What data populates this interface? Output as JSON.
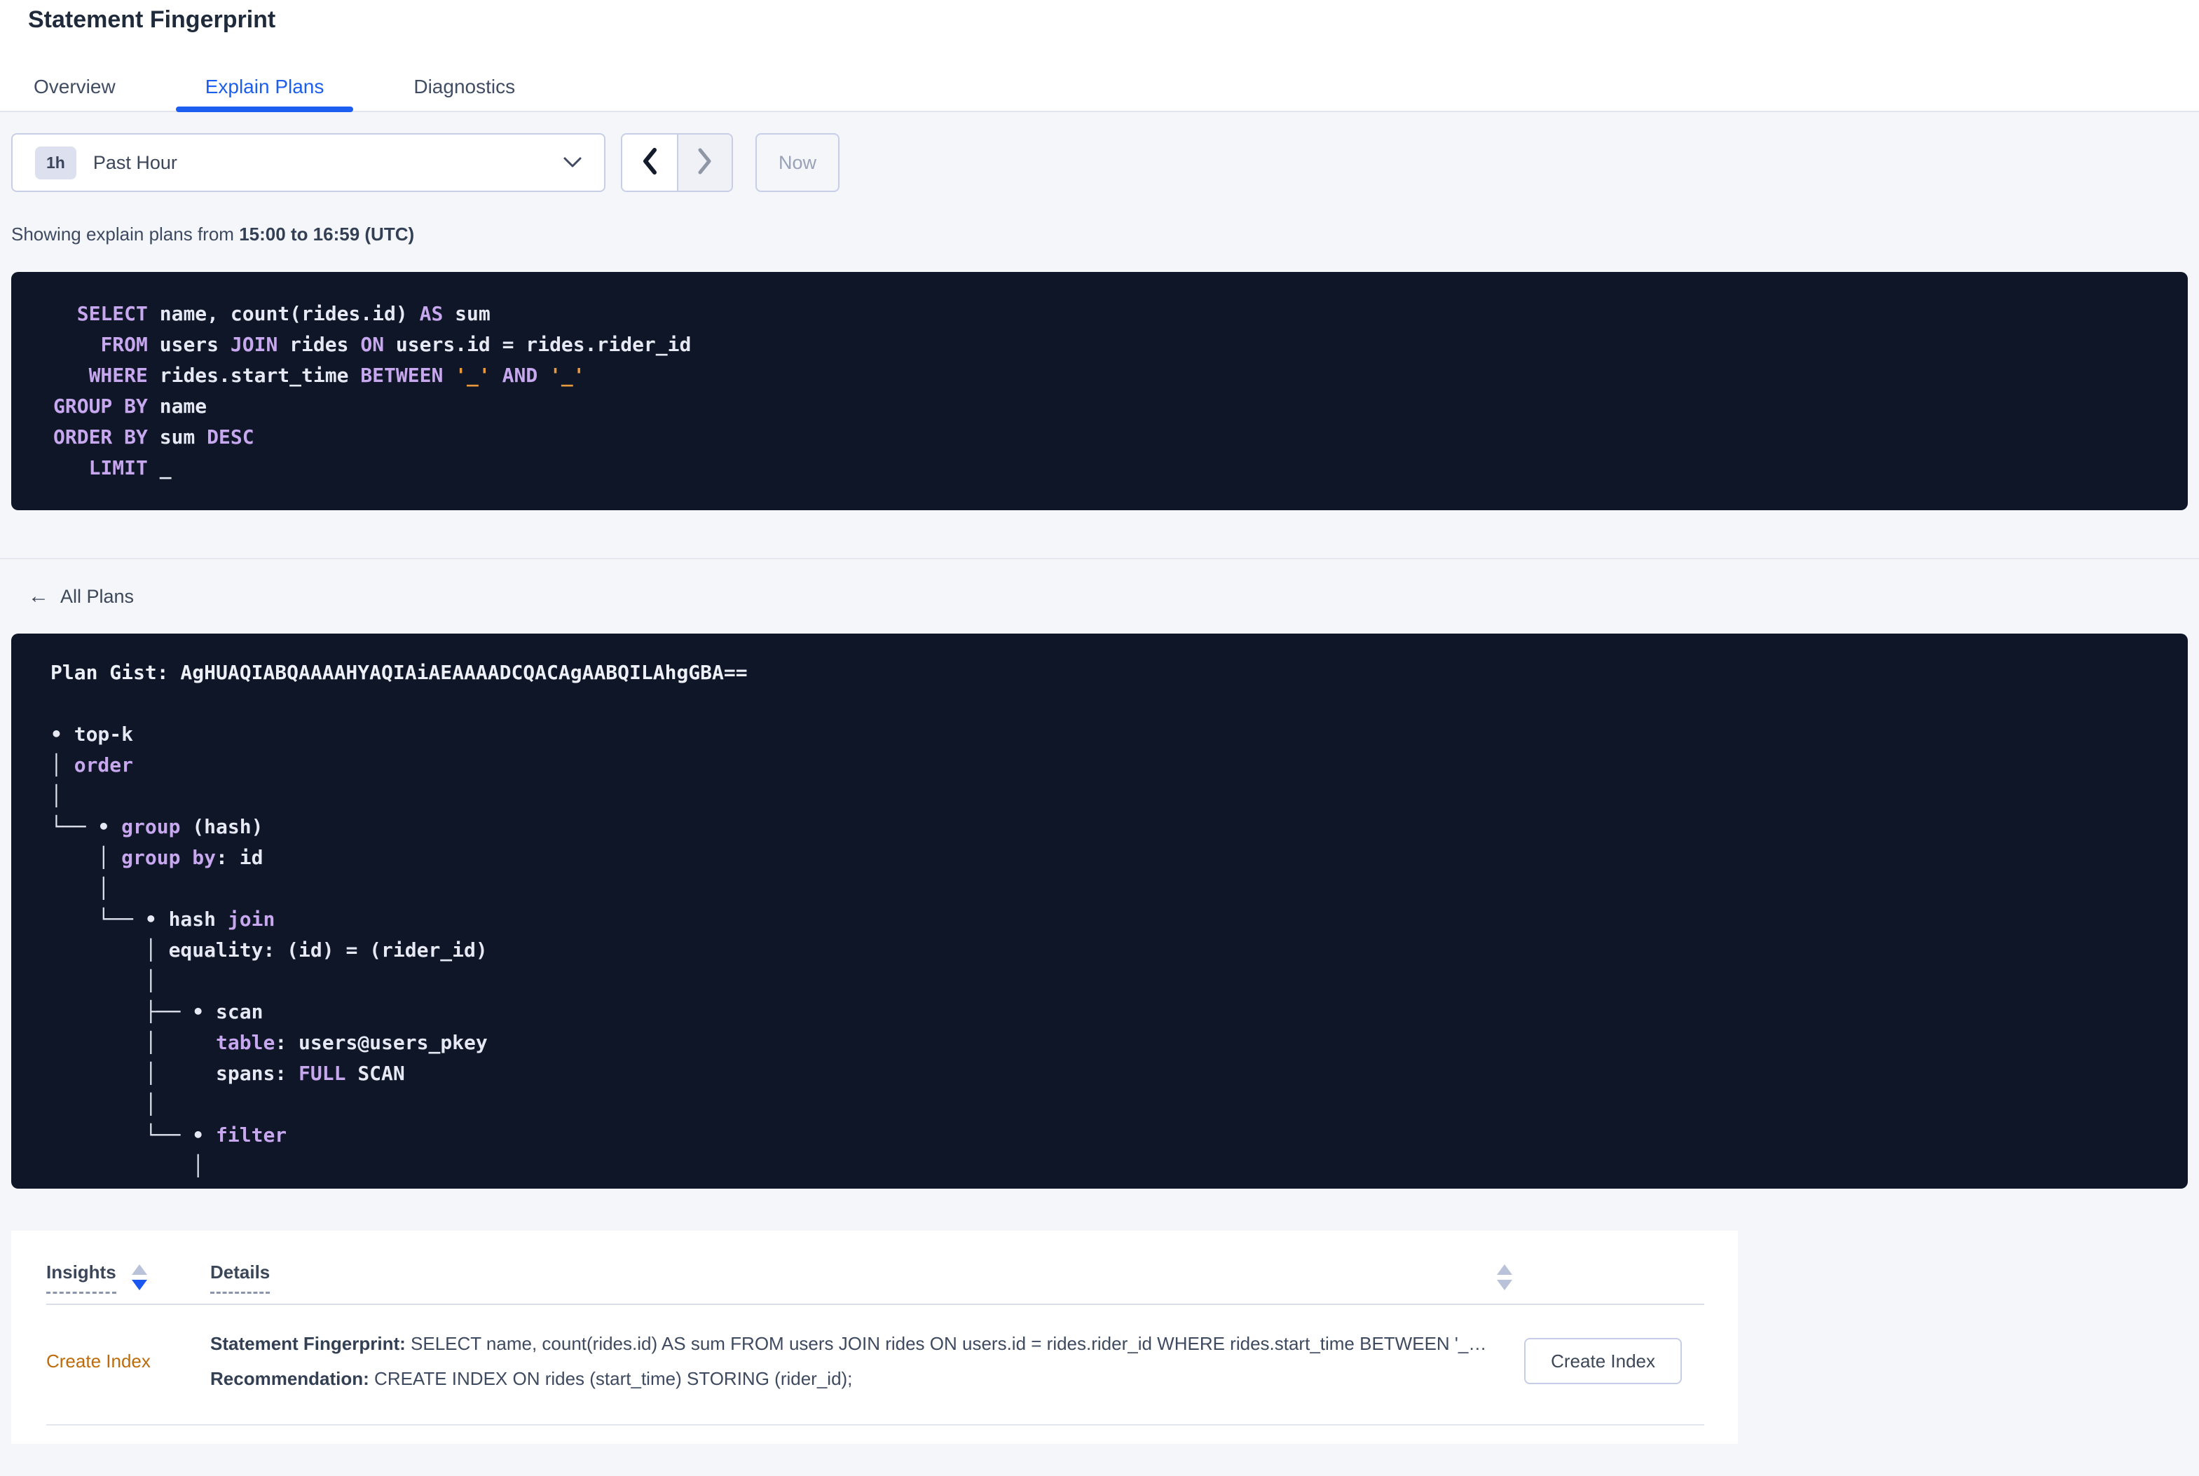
{
  "title": "Statement Fingerprint",
  "tabs": [
    {
      "label": "Overview",
      "active": false
    },
    {
      "label": "Explain Plans",
      "active": true
    },
    {
      "label": "Diagnostics",
      "active": false
    }
  ],
  "toolbar": {
    "range_badge": "1h",
    "range_label": "Past Hour",
    "now_label": "Now"
  },
  "status_line": {
    "prefix": "Showing explain plans from ",
    "bold_range": "15:00 to 16:59 (UTC)"
  },
  "sql_code": {
    "lines": [
      [
        [
          "w",
          "  "
        ],
        [
          "kw",
          "SELECT"
        ],
        [
          "w",
          " name, count(rides.id) "
        ],
        [
          "kw",
          "AS"
        ],
        [
          "w",
          " sum"
        ]
      ],
      [
        [
          "w",
          "    "
        ],
        [
          "kw",
          "FROM"
        ],
        [
          "w",
          " users "
        ],
        [
          "kw",
          "JOIN"
        ],
        [
          "w",
          " rides "
        ],
        [
          "kw",
          "ON"
        ],
        [
          "w",
          " users.id = rides.rider_id"
        ]
      ],
      [
        [
          "w",
          "   "
        ],
        [
          "kw",
          "WHERE"
        ],
        [
          "w",
          " rides.start_time "
        ],
        [
          "kw",
          "BETWEEN"
        ],
        [
          "w",
          " "
        ],
        [
          "lit",
          "'_'"
        ],
        [
          "w",
          " "
        ],
        [
          "kw",
          "AND"
        ],
        [
          "w",
          " "
        ],
        [
          "lit",
          "'_'"
        ]
      ],
      [
        [
          "kw",
          "GROUP BY"
        ],
        [
          "w",
          " name"
        ]
      ],
      [
        [
          "kw",
          "ORDER BY"
        ],
        [
          "w",
          " sum "
        ],
        [
          "kw",
          "DESC"
        ]
      ],
      [
        [
          "w",
          "   "
        ],
        [
          "kw",
          "LIMIT"
        ],
        [
          "w",
          " _"
        ]
      ]
    ]
  },
  "back_link": {
    "label": "All Plans"
  },
  "plan_code": {
    "lines": [
      [
        [
          "b",
          "Plan Gist: AgHUAQIABQAAAAHYAQIAiAEAAAADCQACAgAABQILAhgGBA=="
        ]
      ],
      [],
      [
        [
          "w",
          "• top-k"
        ]
      ],
      [
        [
          "t",
          "│ "
        ],
        [
          "kw",
          "order"
        ]
      ],
      [
        [
          "t",
          "│"
        ]
      ],
      [
        [
          "t",
          "└── "
        ],
        [
          "w",
          "• "
        ],
        [
          "kw",
          "group"
        ],
        [
          "w",
          " (hash)"
        ]
      ],
      [
        [
          "t",
          "    │ "
        ],
        [
          "kw",
          "group by"
        ],
        [
          "w",
          ": id"
        ]
      ],
      [
        [
          "t",
          "    │"
        ]
      ],
      [
        [
          "t",
          "    └── "
        ],
        [
          "w",
          "• hash "
        ],
        [
          "kw",
          "join"
        ]
      ],
      [
        [
          "t",
          "        │ "
        ],
        [
          "w",
          "equality: (id) = (rider_id)"
        ]
      ],
      [
        [
          "t",
          "        │"
        ]
      ],
      [
        [
          "t",
          "        ├── "
        ],
        [
          "w",
          "• scan"
        ]
      ],
      [
        [
          "t",
          "        │     "
        ],
        [
          "kw",
          "table"
        ],
        [
          "w",
          ": users@users_pkey"
        ]
      ],
      [
        [
          "t",
          "        │     "
        ],
        [
          "w",
          "spans: "
        ],
        [
          "kw",
          "FULL"
        ],
        [
          "w",
          " SCAN"
        ]
      ],
      [
        [
          "t",
          "        │"
        ]
      ],
      [
        [
          "t",
          "        └── "
        ],
        [
          "w",
          "• "
        ],
        [
          "kw",
          "filter"
        ]
      ],
      [
        [
          "t",
          "            │"
        ]
      ]
    ]
  },
  "insights_table": {
    "columns": [
      {
        "label": "Insights",
        "sort": "desc"
      },
      {
        "label": "Details",
        "sort": "none"
      }
    ],
    "row": {
      "insight": "Create Index",
      "fingerprint_label": "Statement Fingerprint:",
      "fingerprint_value": " SELECT name, count(rides.id) AS sum FROM users JOIN rides ON users.id = rides.rider_id WHERE rides.start_time BETWEEN '_…",
      "recommendation_label": "Recommendation:",
      "recommendation_value": " CREATE INDEX ON rides (start_time) STORING (rider_id);",
      "action_label": "Create Index"
    }
  },
  "colors": {
    "accent_blue": "#1c5ef0",
    "code_background": "#0e1628",
    "keyword_purple": "#c7a7ee",
    "placeholder_orange": "#e8993b",
    "insight_link_orange": "#bd6c0c",
    "page_background": "#f4f6fa"
  }
}
